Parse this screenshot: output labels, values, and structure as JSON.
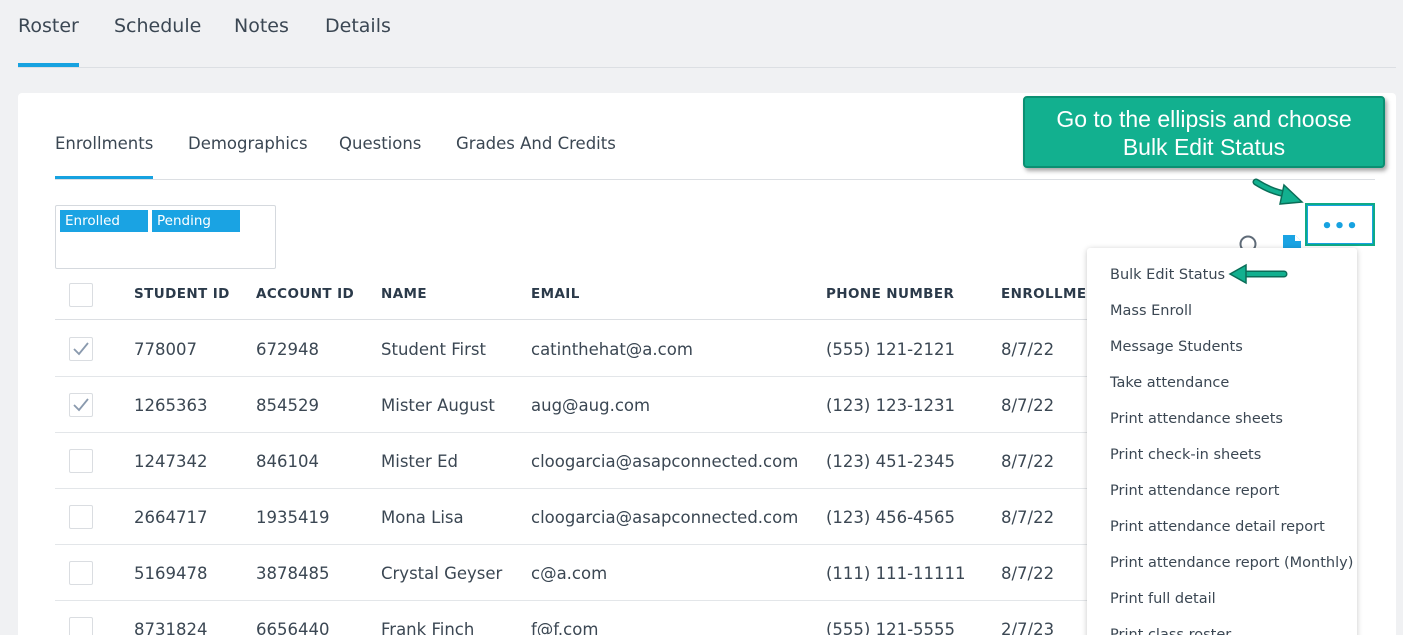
{
  "top_tabs": [
    {
      "label": "Roster"
    },
    {
      "label": "Schedule"
    },
    {
      "label": "Notes"
    },
    {
      "label": "Details"
    }
  ],
  "active_top_tab": "Roster",
  "sub_tabs": [
    {
      "label": "Enrollments"
    },
    {
      "label": "Demographics"
    },
    {
      "label": "Questions"
    },
    {
      "label": "Grades And Credits"
    }
  ],
  "active_sub_tab": "Enrollments",
  "filters": {
    "chips": [
      {
        "label": "Enrolled"
      },
      {
        "label": "Pending"
      }
    ]
  },
  "table": {
    "headers": {
      "student_id": "STUDENT ID",
      "account_id": "ACCOUNT ID",
      "name": "NAME",
      "email": "EMAIL",
      "phone": "PHONE NUMBER",
      "enrollment": "ENROLLMEN"
    },
    "rows": [
      {
        "checked": true,
        "student_id": "778007",
        "account_id": "672948",
        "name": "Student First",
        "email": "catinthehat@a.com",
        "phone": "(555) 121-2121",
        "enrollment": "8/7/22"
      },
      {
        "checked": true,
        "student_id": "1265363",
        "account_id": "854529",
        "name": "Mister August",
        "email": "aug@aug.com",
        "phone": "(123) 123-1231",
        "enrollment": "8/7/22"
      },
      {
        "checked": false,
        "student_id": "1247342",
        "account_id": "846104",
        "name": "Mister Ed",
        "email": "cloogarcia@asapconnected.com",
        "phone": "(123) 451-2345",
        "enrollment": "8/7/22"
      },
      {
        "checked": false,
        "student_id": "2664717",
        "account_id": "1935419",
        "name": "Mona Lisa",
        "email": "cloogarcia@asapconnected.com",
        "phone": "(123) 456-4565",
        "enrollment": "8/7/22"
      },
      {
        "checked": false,
        "student_id": "5169478",
        "account_id": "3878485",
        "name": "Crystal Geyser",
        "email": "c@a.com",
        "phone": "(111) 111-11111",
        "enrollment": "8/7/22"
      },
      {
        "checked": false,
        "student_id": "8731824",
        "account_id": "6656440",
        "name": "Frank Finch",
        "email": "f@f.com",
        "phone": "(555) 121-5555",
        "enrollment": "2/7/23"
      }
    ]
  },
  "toolbar": {
    "icons": [
      "search-icon",
      "document-icon"
    ],
    "ellipsis_label": "•••"
  },
  "menu": {
    "items": [
      {
        "label": "Bulk Edit Status"
      },
      {
        "label": "Mass Enroll"
      },
      {
        "label": "Message Students"
      },
      {
        "label": "Take attendance"
      },
      {
        "label": "Print attendance sheets"
      },
      {
        "label": "Print check-in sheets"
      },
      {
        "label": "Print attendance report"
      },
      {
        "label": "Print attendance detail report"
      },
      {
        "label": "Print attendance report (Monthly)"
      },
      {
        "label": "Print full detail"
      },
      {
        "label": "Print class roster"
      }
    ]
  },
  "callout": {
    "line1": "Go to the ellipsis and choose",
    "line2": "Bulk Edit Status"
  },
  "colors": {
    "accent": "#17a2e0",
    "callout": "#12b08f",
    "callout_border": "#0a8f72"
  }
}
